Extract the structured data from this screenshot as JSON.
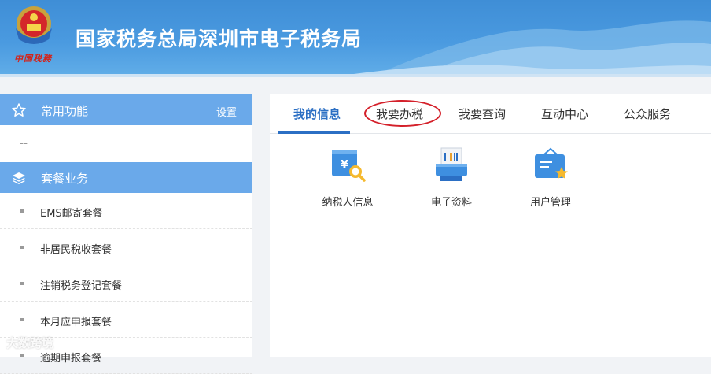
{
  "header": {
    "title": "国家税务总局深圳市电子税务局",
    "signature": "中国税務"
  },
  "sidebar": {
    "favorites": {
      "label": "常用功能",
      "settings_label": "设置",
      "empty_text": "--"
    },
    "packages": {
      "label": "套餐业务",
      "items": [
        {
          "label": "EMS邮寄套餐"
        },
        {
          "label": "非居民税收套餐"
        },
        {
          "label": "注销税务登记套餐"
        },
        {
          "label": "本月应申报套餐"
        },
        {
          "label": "逾期申报套餐"
        }
      ]
    }
  },
  "tabs": [
    {
      "label": "我的信息",
      "active": true
    },
    {
      "label": "我要办税",
      "active": false
    },
    {
      "label": "我要查询",
      "active": false
    },
    {
      "label": "互动中心",
      "active": false
    },
    {
      "label": "公众服务",
      "active": false
    }
  ],
  "apps": [
    {
      "label": "纳税人信息",
      "icon": "taxpayer-info-icon"
    },
    {
      "label": "电子资料",
      "icon": "electronic-documents-icon"
    },
    {
      "label": "用户管理",
      "icon": "user-management-icon"
    }
  ],
  "watermark": "大数跨境",
  "colors": {
    "header": "#4a9ae0",
    "sidebar_head": "#6aa9ea",
    "accent": "#2b6fc4",
    "annotation": "#d4202a"
  }
}
